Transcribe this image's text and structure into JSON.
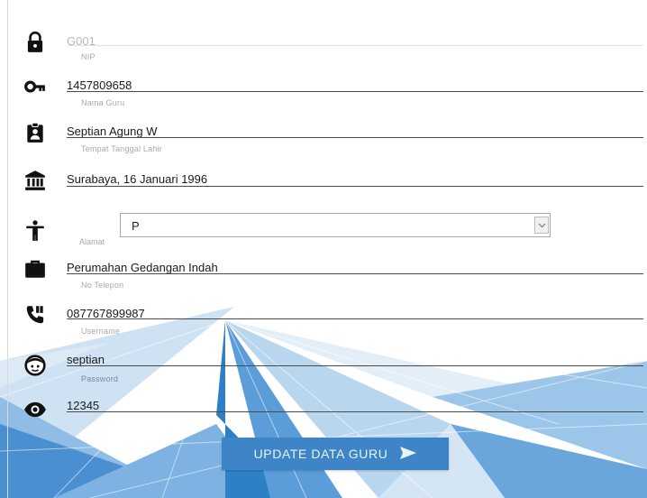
{
  "form": {
    "kode": {
      "value": "G001",
      "icon": "lock-icon"
    },
    "nip": {
      "label": "NIP",
      "value": "1457809658",
      "icon": "key-icon"
    },
    "nama": {
      "label": "Nama Guru",
      "value": "Septian Agung W",
      "icon": "id-badge-icon"
    },
    "ttl": {
      "label": "Tempat Tanggal Lahir",
      "value": "Surabaya, 16 Januari 1996",
      "icon": "bank-icon"
    },
    "gender": {
      "label": "Alamat",
      "selected": "P",
      "icon": "person-icon"
    },
    "alamat": {
      "label": "",
      "value": "Perumahan Gedangan Indah",
      "icon": "briefcase-icon"
    },
    "telepon": {
      "label": "No Telepon",
      "value": "087767899987",
      "icon": "phone-icon"
    },
    "username": {
      "label": "Username",
      "value": "septian",
      "icon": "face-icon"
    },
    "password": {
      "label": "Password",
      "value": "12345",
      "icon": "eye-icon"
    }
  },
  "actions": {
    "update_label": "UPDATE DATA GURU"
  },
  "colors": {
    "accent": "#3d85c6",
    "background_art": "#4f93cf"
  }
}
